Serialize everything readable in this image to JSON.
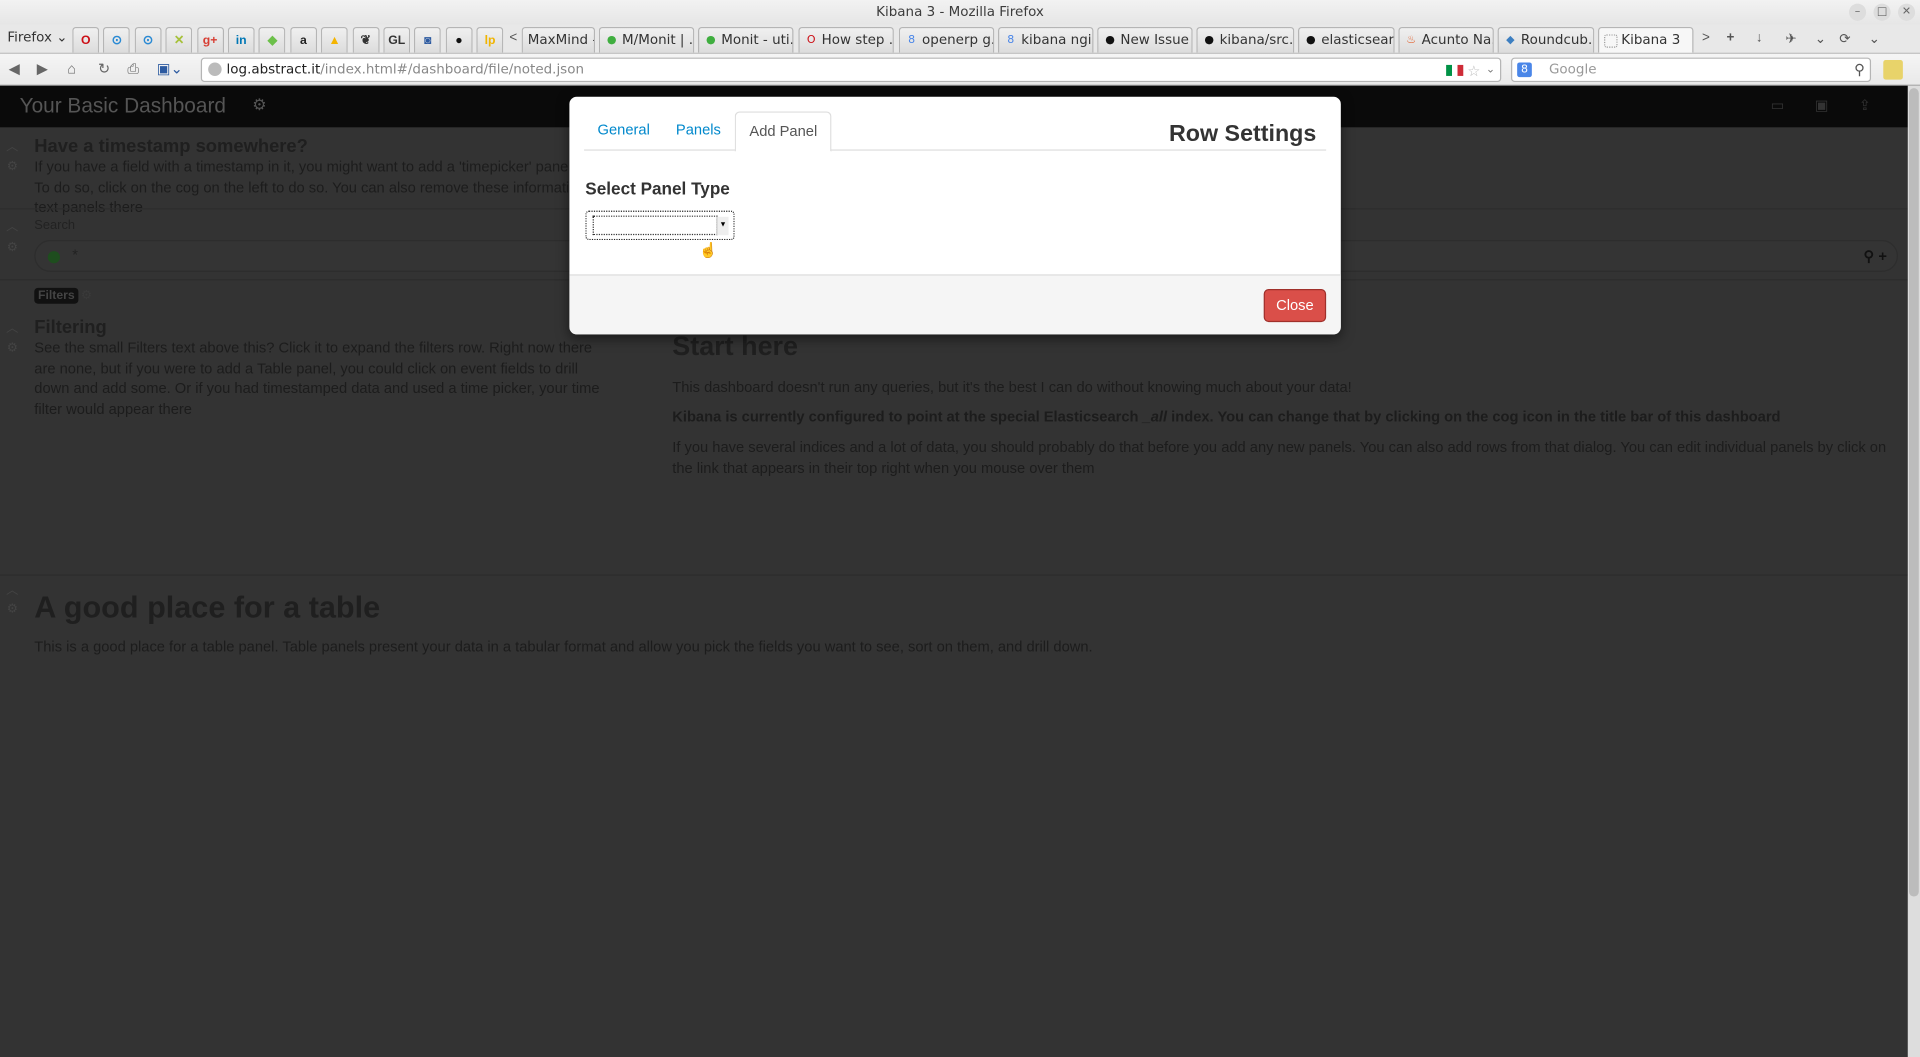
{
  "window": {
    "title": "Kibana 3 - Mozilla Firefox",
    "controls": [
      "minimize",
      "maximize",
      "close"
    ]
  },
  "browser": {
    "menu_label": "Firefox",
    "app_tabs": [
      {
        "name": "opera",
        "glyph": "O",
        "color": "#cc0f16"
      },
      {
        "name": "app-circle-1",
        "glyph": "⊙",
        "color": "#2a8ad4"
      },
      {
        "name": "app-circle-2",
        "glyph": "⊙",
        "color": "#2a8ad4"
      },
      {
        "name": "app-x",
        "glyph": "✕",
        "color": "#a6c13a"
      },
      {
        "name": "google-plus",
        "glyph": "g+",
        "color": "#d73d32"
      },
      {
        "name": "linkedin",
        "glyph": "in",
        "color": "#0077b5"
      },
      {
        "name": "feedly",
        "glyph": "◆",
        "color": "#6cc04a"
      },
      {
        "name": "amazon",
        "glyph": "a",
        "color": "#222222"
      },
      {
        "name": "google-drive",
        "glyph": "▲",
        "color": "#f4b400"
      },
      {
        "name": "gnome",
        "glyph": "❦",
        "color": "#333333"
      },
      {
        "name": "gitlab",
        "glyph": "GL",
        "color": "#333333"
      },
      {
        "name": "bin",
        "glyph": "◙",
        "color": "#2c5aa0"
      },
      {
        "name": "github",
        "glyph": "●",
        "color": "#111111"
      },
      {
        "name": "lastpass",
        "glyph": "lp",
        "color": "#f0b400"
      }
    ],
    "scroll_left": "<",
    "tabs": [
      {
        "label": "MaxMind -...",
        "fav": "",
        "fav_color": "#dcdcdc",
        "active": false
      },
      {
        "label": "M/Monit | ...",
        "fav": "●",
        "fav_color": "#3fae3f",
        "active": false
      },
      {
        "label": "Monit - uti...",
        "fav": "●",
        "fav_color": "#3fae3f",
        "active": false
      },
      {
        "label": "How step ...",
        "fav": "O",
        "fav_color": "#cc0f16",
        "active": false
      },
      {
        "label": "openerp g...",
        "fav": "8",
        "fav_color": "#4a86e8",
        "active": false
      },
      {
        "label": "kibana ngi...",
        "fav": "8",
        "fav_color": "#4a86e8",
        "active": false
      },
      {
        "label": "New Issue ...",
        "fav": "●",
        "fav_color": "#111111",
        "active": false
      },
      {
        "label": "kibana/src...",
        "fav": "●",
        "fav_color": "#111111",
        "active": false
      },
      {
        "label": "elasticsear...",
        "fav": "●",
        "fav_color": "#111111",
        "active": false
      },
      {
        "label": "Acunto Na...",
        "fav": "♨",
        "fav_color": "#e2541c",
        "active": false
      },
      {
        "label": "Roundcub...",
        "fav": "◆",
        "fav_color": "#3d7fc1",
        "active": false
      },
      {
        "label": "Kibana 3",
        "fav": "",
        "fav_color": "#ffffff",
        "active": true
      }
    ],
    "active_tab_close": "✕",
    "strip_buttons": {
      "scroll_right": ">",
      "new_tab": "+",
      "download": "↓",
      "list": "⌄"
    },
    "nav": {
      "back": "◀",
      "forward": "▶",
      "home": "⌂",
      "reload": "↻",
      "print": "⎙"
    },
    "url": {
      "host": "log.abstract.it",
      "path": "/index.html#/dashboard/file/noted.json"
    },
    "search": {
      "engine": "Google",
      "placeholder": "Google"
    }
  },
  "kibana": {
    "dashboard_title": "Your Basic Dashboard",
    "rows": [
      {
        "heading": "Have a timestamp somewhere?",
        "text": "If you have a field with a timestamp in it, you might want to add a 'timepicker' panel here. To do so, click on the cog on the left to do so. You can also remove these information text panels there"
      },
      {
        "search_label": "Search",
        "query": "*",
        "status_color": "#1e4d1e"
      },
      {
        "filters_label": "Filters",
        "filtering_heading": "Filtering",
        "filtering_text": "See the small Filters text above this? Click it to expand the filters row. Right now there are none, but if you were to add a Table panel, you could click on event fields to drill down and add some. Or if you had timestamped data and used a time picker, your time filter would appear there",
        "start_heading": "Start here",
        "start_p1": "This dashboard doesn't run any queries, but it's the best I can do without knowing much about your data!",
        "start_p2_a": "Kibana is currently configured to point at the special Elasticsearch ",
        "start_p2_em": "_all",
        "start_p2_b": " index. You can change that by clicking on the cog icon in the title bar of this dashboard",
        "start_p3": "If you have several indices and a lot of data, you should probably do that before you add any new panels. You can also add rows from that dialog. You can edit individual panels by click on the link that appears in their top right when you mouse over them"
      },
      {
        "heading": "A good place for a table",
        "text": "This is a good place for a table panel. Table panels present your data in a tabular format and allow you pick the fields you want to see, sort on them, and drill down."
      }
    ]
  },
  "modal": {
    "title": "Row Settings",
    "tabs": [
      {
        "label": "General",
        "active": false
      },
      {
        "label": "Panels",
        "active": false
      },
      {
        "label": "Add Panel",
        "active": true
      }
    ],
    "select_label": "Select Panel Type",
    "select_value": "",
    "close_label": "Close",
    "close_color": "#da4f49"
  }
}
